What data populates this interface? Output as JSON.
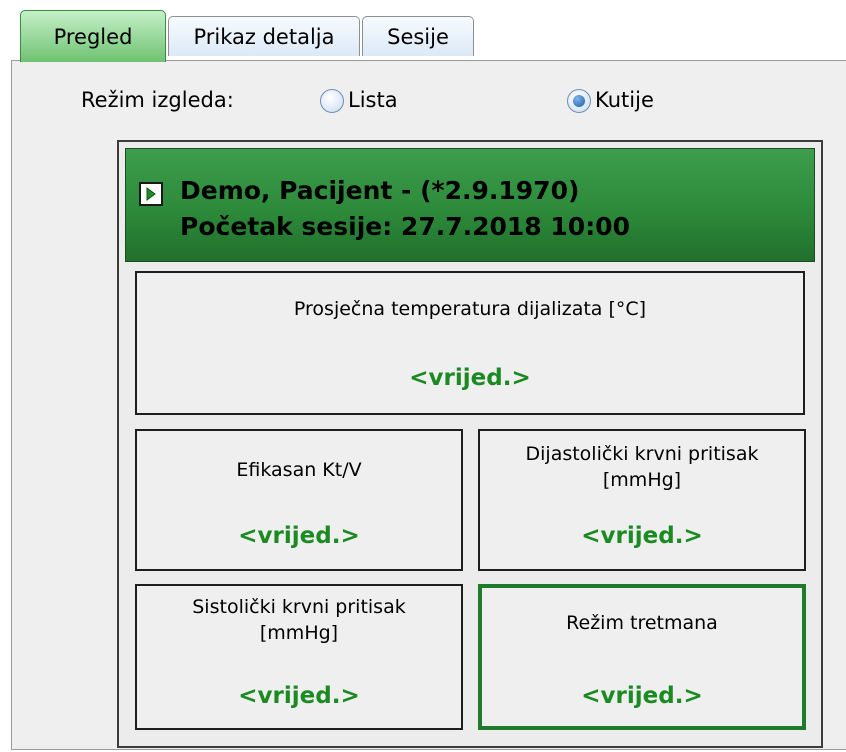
{
  "tabs": [
    {
      "label": "Pregled",
      "active": true
    },
    {
      "label": "Prikaz detalja",
      "active": false
    },
    {
      "label": "Sesije",
      "active": false
    }
  ],
  "view_mode": {
    "label": "Režim izgleda:",
    "options": [
      {
        "label": "Lista",
        "selected": false
      },
      {
        "label": "Kutije",
        "selected": true
      }
    ]
  },
  "patient_card": {
    "header_line1": "Demo, Pacijent - (*2.9.1970)",
    "header_line2": "Početak sesije: 27.7.2018 10:00",
    "boxes": [
      {
        "label": "Prosječna temperatura dijalizata [°C]",
        "value": "<vrijed.>"
      },
      {
        "label": "Efikasan Kt/V",
        "value": "<vrijed.>"
      },
      {
        "label": "Dijastolički krvni pritisak [mmHg]",
        "value": "<vrijed.>"
      },
      {
        "label": "Sistolički krvni pritisak [mmHg]",
        "value": "<vrijed.>"
      },
      {
        "label": "Režim tretmana",
        "value": "<vrijed.>",
        "highlighted": true
      }
    ]
  },
  "colors": {
    "header_green": "#2d8a3a",
    "value_green": "#1b8a22",
    "active_tab_green": "#6fc272"
  }
}
